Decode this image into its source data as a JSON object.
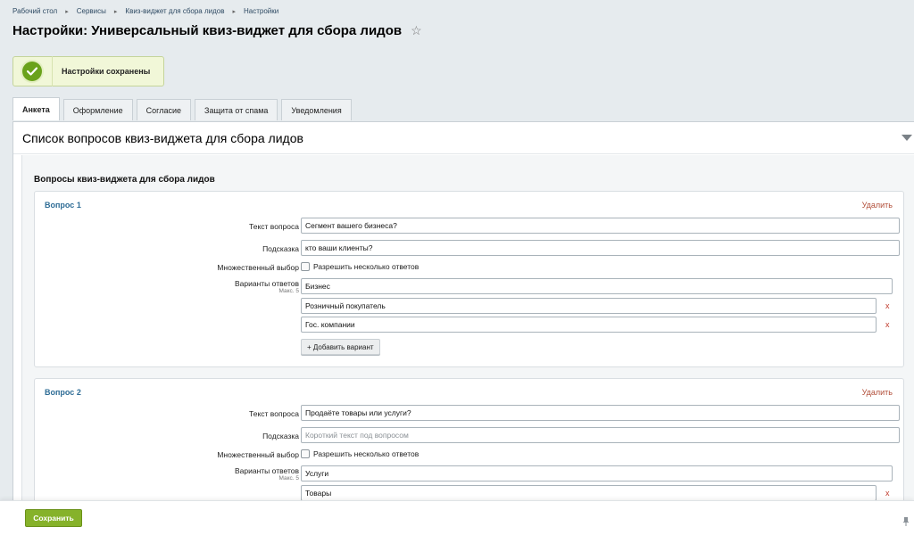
{
  "breadcrumb": [
    "Рабочий стол",
    "Сервисы",
    "Квиз-виджет для сбора лидов",
    "Настройки"
  ],
  "page_title": "Настройки: Универсальный квиз-виджет для сбора лидов",
  "notice": {
    "text": "Настройки сохранены"
  },
  "tabs": [
    "Анкета",
    "Оформление",
    "Согласие",
    "Защита от спама",
    "Уведомления"
  ],
  "active_tab": "Анкета",
  "section": {
    "title": "Список вопросов квиз-виджета для сбора лидов",
    "subtitle": "Вопросы квиз-виджета для сбора лидов"
  },
  "labels": {
    "question_text": "Текст вопроса",
    "hint": "Подсказка",
    "multiple": "Множественный выбор",
    "allow_multiple": "Разрешить несколько ответов",
    "options": "Варианты ответов",
    "max": "Макс. 5",
    "delete": "Удалить",
    "add_option": "+ Добавить вариант",
    "remove": "x"
  },
  "questions": [
    {
      "title": "Вопрос 1",
      "text": "Сегмент вашего бизнеса?",
      "hint": "кто ваши клиенты?",
      "hint_placeholder": "",
      "multiple": false,
      "options": [
        "Бизнес",
        "Розничный покупатель",
        "Гос. компании"
      ]
    },
    {
      "title": "Вопрос 2",
      "text": "Продаёте товары или услуги?",
      "hint": "",
      "hint_placeholder": "Короткий текст под вопросом",
      "multiple": false,
      "options": [
        "Услуги",
        "Товары"
      ]
    }
  ],
  "footer": {
    "save_label": "Сохранить"
  },
  "colors": {
    "accent_green": "#86b22a",
    "link_blue": "#2f6d96",
    "delete_red": "#b24f3a"
  }
}
